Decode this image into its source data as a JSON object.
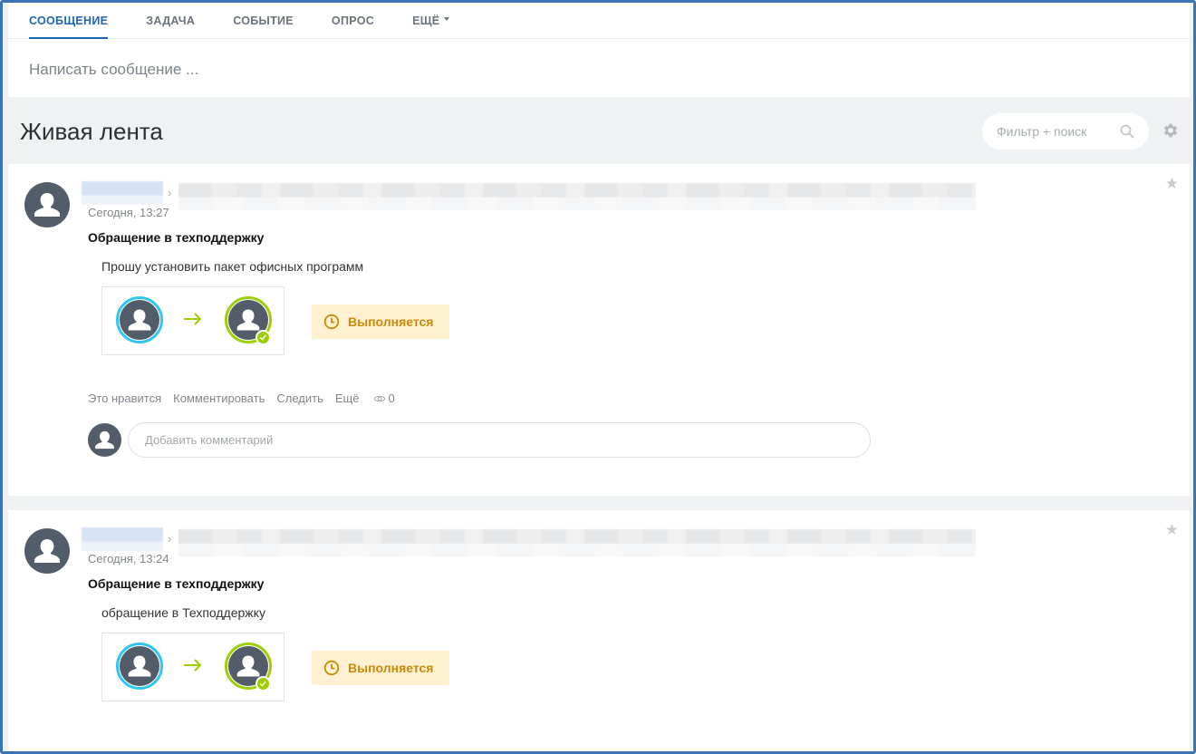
{
  "composer": {
    "tabs": [
      {
        "label": "СООБЩЕНИЕ",
        "active": true
      },
      {
        "label": "ЗАДАЧА",
        "active": false
      },
      {
        "label": "СОБЫТИЕ",
        "active": false
      },
      {
        "label": "ОПРОС",
        "active": false
      },
      {
        "label": "ЕЩЁ",
        "active": false
      }
    ],
    "placeholder": "Написать сообщение ..."
  },
  "feed": {
    "title": "Живая лента",
    "filter_placeholder": "Фильтр + поиск"
  },
  "posts": [
    {
      "time": "Сегодня, 13:27",
      "title": "Обращение в техподдержку",
      "text": "Прошу установить пакет офисных программ",
      "status": "Выполняется",
      "actions": {
        "like": "Это нравится",
        "comment": "Комментировать",
        "follow": "Следить",
        "more": "Ещё"
      },
      "views": "0",
      "comment_placeholder": "Добавить комментарий"
    },
    {
      "time": "Сегодня, 13:24",
      "title": "Обращение в техподдержку",
      "text": "обращение в Техподдержку",
      "status": "Выполняется"
    }
  ],
  "colors": {
    "accent": "#2067b0",
    "status_bg": "#fff0cf",
    "status_text": "#c98a09",
    "from_ring": "#2fc6f6",
    "to_ring": "#9dcf00"
  },
  "icons": [
    "search-icon",
    "gear-icon",
    "star-icon",
    "user-avatar-icon",
    "arrow-right-icon",
    "check-icon",
    "clock-icon",
    "eye-icon"
  ]
}
